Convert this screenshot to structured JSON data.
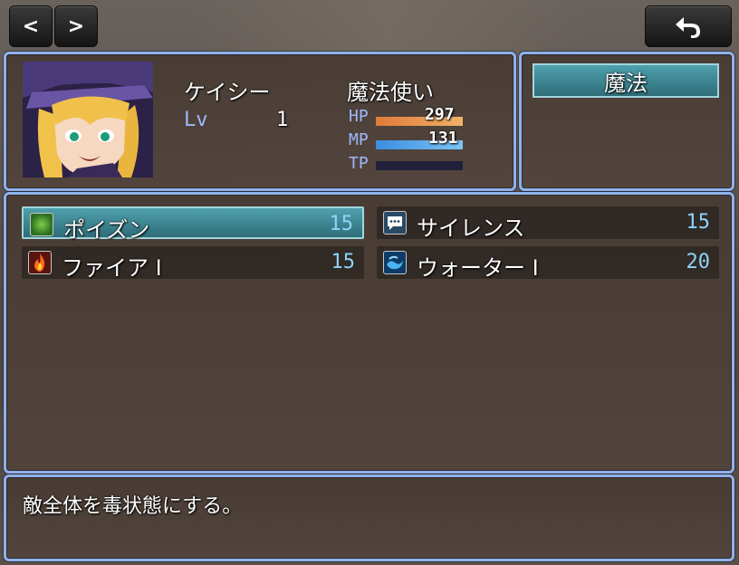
{
  "topbar": {
    "prev_label": "<",
    "next_label": ">",
    "back_icon": "back-arrow-icon"
  },
  "actor": {
    "name": "ケイシー",
    "class": "魔法使い",
    "level_label": "Lv",
    "level": "1",
    "hp_label": "HP",
    "hp": "297",
    "hp_ratio": 1.0,
    "mp_label": "MP",
    "mp": "131",
    "mp_ratio": 1.0,
    "tp_label": "TP",
    "tp_ratio": 0.0
  },
  "skill_type": {
    "label": "魔法"
  },
  "skills": [
    {
      "name": "ポイズン",
      "cost": "15",
      "icon": "poison-icon",
      "selected": true
    },
    {
      "name": "サイレンス",
      "cost": "15",
      "icon": "silence-icon",
      "selected": false
    },
    {
      "name": "ファイア I",
      "cost": "15",
      "icon": "fire-icon",
      "selected": false
    },
    {
      "name": "ウォーター I",
      "cost": "20",
      "icon": "water-icon",
      "selected": false
    }
  ],
  "help": {
    "text": "敵全体を毒状態にする。"
  },
  "colors": {
    "hp_gauge": "#e8954a",
    "mp_gauge": "#4aa4e8",
    "tp_gauge": "#20203a",
    "cost_text": "#8dd3f7",
    "window_border": "#8fb2ea",
    "stat_label": "#9fb7ff"
  }
}
